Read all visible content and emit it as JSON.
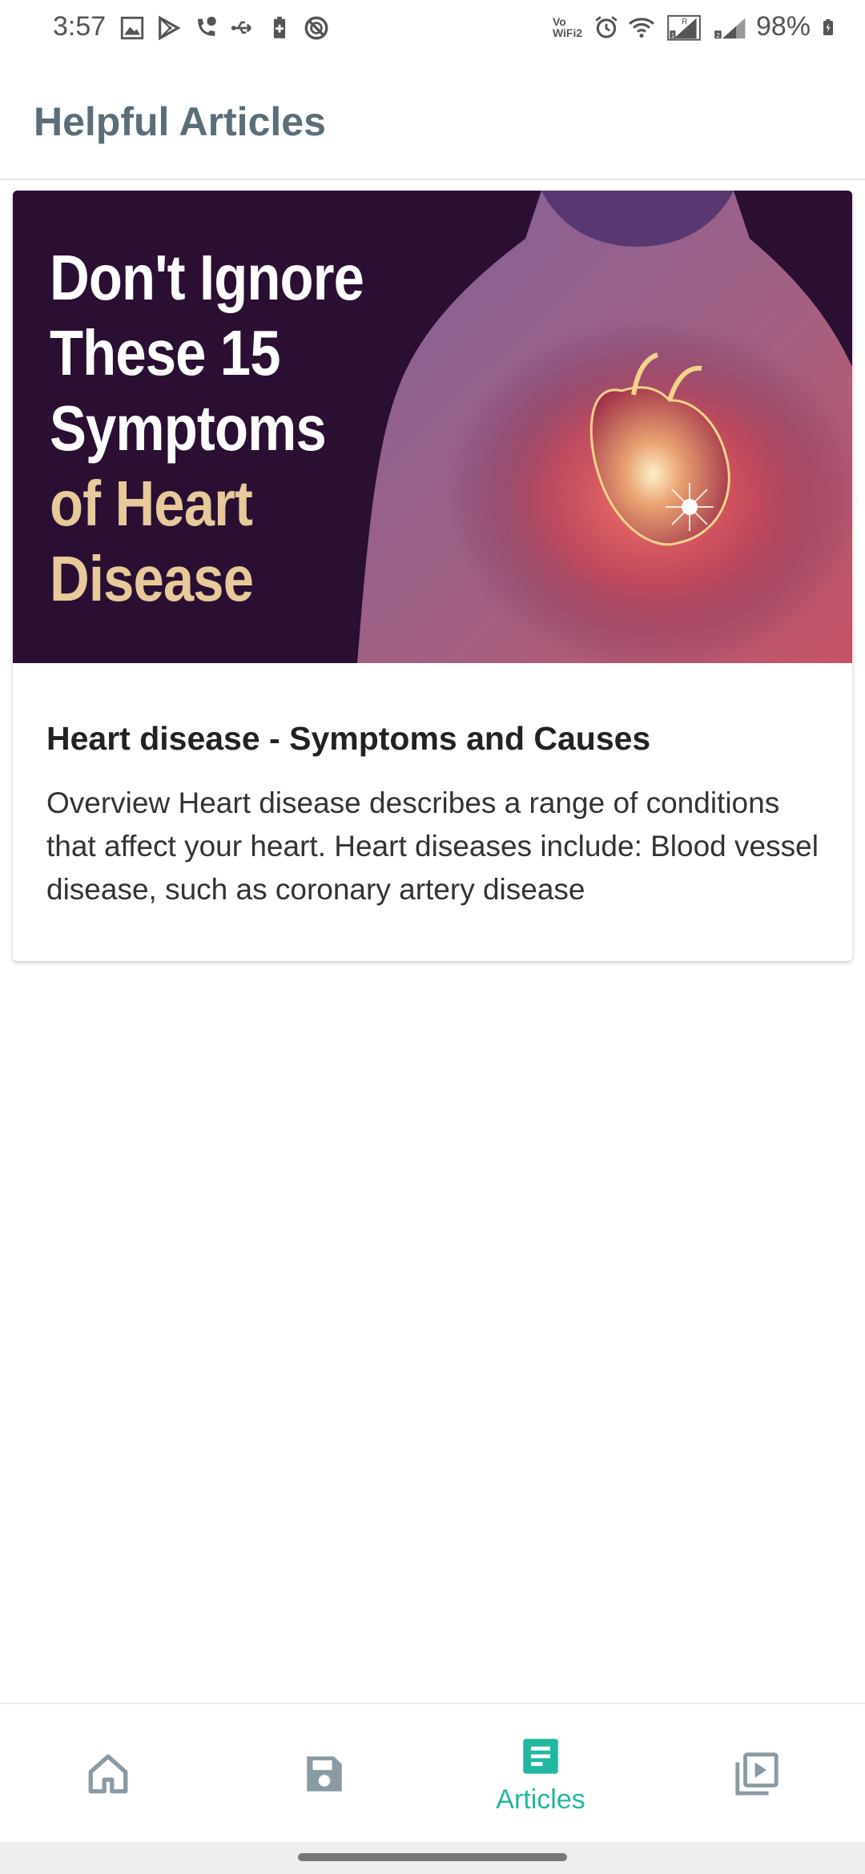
{
  "status_bar": {
    "time": "3:57",
    "vowifi_line1": "Vo",
    "vowifi_line2": "WiFi2",
    "battery_percent": "98%",
    "left_icons": [
      "gallery-icon",
      "play-store-icon",
      "missed-call-icon",
      "usb-icon",
      "battery-saver-icon",
      "dnd-icon"
    ],
    "right_icons": [
      "alarm-icon",
      "wifi-icon",
      "signal-sim1-icon",
      "signal-sim2-icon",
      "battery-icon"
    ]
  },
  "app_bar": {
    "title": "Helpful Articles"
  },
  "article": {
    "image_lines": {
      "line1": "Don't Ignore",
      "line2": "These 15",
      "line3": "Symptoms",
      "line4": "of Heart",
      "line5": "Disease"
    },
    "title": "Heart disease - Symptoms and Causes",
    "description": "Overview Heart disease describes a range of conditions that affect your heart. Heart diseases include:  Blood vessel disease, such as coronary artery disease"
  },
  "bottom_nav": {
    "items": [
      {
        "icon": "home-icon",
        "label": ""
      },
      {
        "icon": "save-icon",
        "label": ""
      },
      {
        "icon": "articles-icon",
        "label": "Articles",
        "active": true
      },
      {
        "icon": "video-library-icon",
        "label": ""
      }
    ]
  },
  "colors": {
    "accent": "#22b8a0",
    "title_gray": "#5b6e78",
    "inactive_icon": "#8a9aa4",
    "image_bg": "#2a0f33",
    "headline_highlight": "#e7c99a"
  }
}
